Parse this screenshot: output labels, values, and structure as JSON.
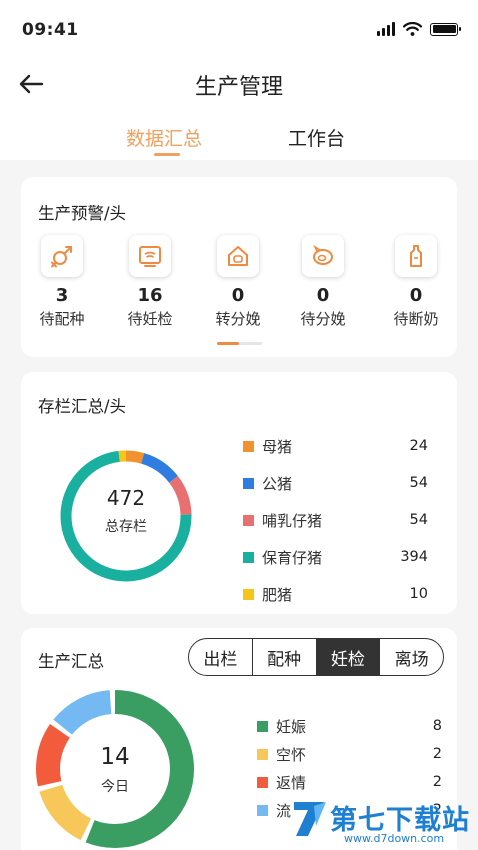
{
  "status_bar": {
    "time": "09:41"
  },
  "header": {
    "title": "生产管理"
  },
  "tabs": [
    {
      "label": "数据汇总",
      "active": true
    },
    {
      "label": "工作台",
      "active": false
    }
  ],
  "warning": {
    "title": "生产预警/头",
    "items": [
      {
        "icon": "mating-icon",
        "count": "3",
        "label": "待配种"
      },
      {
        "icon": "ultrasound-icon",
        "count": "16",
        "label": "待妊检"
      },
      {
        "icon": "farrowing-house-icon",
        "count": "0",
        "label": "转分娩"
      },
      {
        "icon": "pig-icon",
        "count": "0",
        "label": "待分娩"
      },
      {
        "icon": "bottle-icon",
        "count": "0",
        "label": "待断奶"
      }
    ]
  },
  "inventory": {
    "title": "存栏汇总/头",
    "total": "472",
    "total_label": "总存栏"
  },
  "production": {
    "title": "生产汇总",
    "segments": [
      {
        "label": "出栏",
        "active": false
      },
      {
        "label": "配种",
        "active": false
      },
      {
        "label": "妊检",
        "active": true
      },
      {
        "label": "离场",
        "active": false
      }
    ],
    "center_value": "14",
    "center_label": "今日"
  },
  "chart_data": [
    {
      "type": "pie",
      "title": "存栏汇总/头",
      "categories": [
        "母猪",
        "公猪",
        "哺乳仔猪",
        "保育仔猪",
        "肥猪"
      ],
      "values": [
        24,
        54,
        54,
        394,
        10
      ],
      "colors": [
        "#f0922e",
        "#2f7de1",
        "#e87070",
        "#1ab0a0",
        "#f5c518"
      ]
    },
    {
      "type": "pie",
      "title": "生产汇总",
      "categories": [
        "妊娠",
        "空怀",
        "返情",
        "流"
      ],
      "values": [
        8,
        2,
        2,
        2
      ],
      "colors": [
        "#3a9e63",
        "#f7c859",
        "#f25b3c",
        "#74b9f2"
      ]
    }
  ],
  "watermark": {
    "text": "第七下载站",
    "url": "www.d7down.com"
  }
}
